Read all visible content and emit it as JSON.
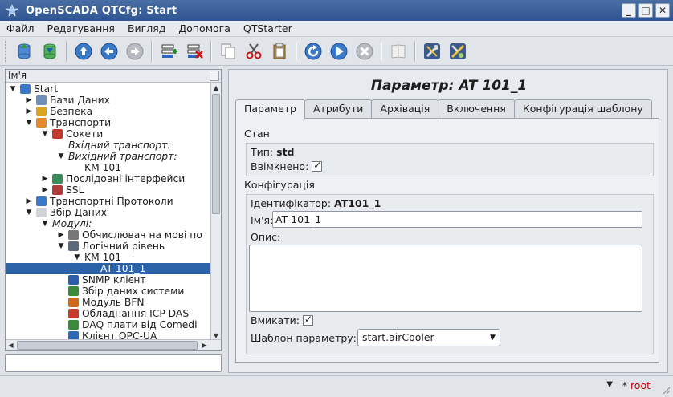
{
  "window": {
    "title": "OpenSCADA QTCfg: Start"
  },
  "menu": [
    "Файл",
    "Редагування",
    "Вигляд",
    "Допомога",
    "QTStarter"
  ],
  "tree": {
    "header": "Ім'я",
    "items": [
      {
        "label": "Start",
        "indent": 0,
        "arrow": "down",
        "icon": "station-icon",
        "italic": false
      },
      {
        "label": "Бази Даних",
        "indent": 1,
        "arrow": "right",
        "icon": "database-icon",
        "italic": false
      },
      {
        "label": "Безпека",
        "indent": 1,
        "arrow": "right",
        "icon": "keys-icon",
        "italic": false
      },
      {
        "label": "Транспорти",
        "indent": 1,
        "arrow": "down",
        "icon": "transport-icon",
        "italic": false
      },
      {
        "label": "Сокети",
        "indent": 2,
        "arrow": "down",
        "icon": "socket-icon",
        "italic": false
      },
      {
        "label": "Вхідний транспорт:",
        "indent": 3,
        "arrow": "",
        "icon": "",
        "italic": true
      },
      {
        "label": "Вихідний транспорт:",
        "indent": 3,
        "arrow": "down",
        "icon": "",
        "italic": true
      },
      {
        "label": "KM 101",
        "indent": 4,
        "arrow": "",
        "icon": "",
        "italic": false
      },
      {
        "label": "Послідовні інтерфейси",
        "indent": 2,
        "arrow": "right",
        "icon": "serial-icon",
        "italic": false
      },
      {
        "label": "SSL",
        "indent": 2,
        "arrow": "right",
        "icon": "ssl-icon",
        "italic": false
      },
      {
        "label": "Транспортні Протоколи",
        "indent": 1,
        "arrow": "right",
        "icon": "protocols-icon",
        "italic": false
      },
      {
        "label": "Збір Даних",
        "indent": 1,
        "arrow": "down",
        "icon": "daq-icon",
        "italic": false
      },
      {
        "label": "Модулі:",
        "indent": 2,
        "arrow": "down",
        "icon": "",
        "italic": true
      },
      {
        "label": "Обчислювач на мові по",
        "indent": 3,
        "arrow": "right",
        "icon": "calculator-icon",
        "italic": false
      },
      {
        "label": "Логічний рівень",
        "indent": 3,
        "arrow": "down",
        "icon": "logic-level-icon",
        "italic": false
      },
      {
        "label": "KM 101",
        "indent": 4,
        "arrow": "down",
        "icon": "",
        "italic": false
      },
      {
        "label": "AT 101_1",
        "indent": 5,
        "arrow": "",
        "icon": "",
        "italic": false,
        "selected": true
      },
      {
        "label": "SNMP клієнт",
        "indent": 3,
        "arrow": "",
        "icon": "snmp-icon",
        "italic": false
      },
      {
        "label": "Збір даних системи",
        "indent": 3,
        "arrow": "",
        "icon": "system-daq-icon",
        "italic": false
      },
      {
        "label": "Модуль BFN",
        "indent": 3,
        "arrow": "",
        "icon": "bfn-icon",
        "italic": false
      },
      {
        "label": "Обладнання ICP DAS",
        "indent": 3,
        "arrow": "",
        "icon": "icpdas-icon",
        "italic": false
      },
      {
        "label": "DAQ плати від Comedi",
        "indent": 3,
        "arrow": "",
        "icon": "comedi-icon",
        "italic": false
      },
      {
        "label": "Клієнт OPC-UA",
        "indent": 3,
        "arrow": "",
        "icon": "opcua-icon",
        "italic": false
      }
    ]
  },
  "panel": {
    "title": "Параметр: AT 101_1",
    "tabs": [
      "Параметр",
      "Атрибути",
      "Архівація",
      "Включення",
      "Конфігурація шаблону"
    ],
    "state": {
      "heading": "Стан",
      "type_label": "Тип:",
      "type_value": "std",
      "enabled_label": "Ввімкнено:"
    },
    "config": {
      "heading": "Конфігурація",
      "id_label": "Ідентифікатор:",
      "id_value": "AT101_1",
      "name_label": "Ім'я:",
      "name_value": "AT 101_1",
      "descr_label": "Опис:",
      "descr_value": "",
      "toenable_label": "Вмикати:",
      "template_label": "Шаблон параметру:",
      "template_value": "start.airCooler"
    }
  },
  "status": {
    "user": "root"
  },
  "colors": {
    "selection": "#2c63a8",
    "user": "#c80000",
    "title_bar": "#2f5590"
  }
}
